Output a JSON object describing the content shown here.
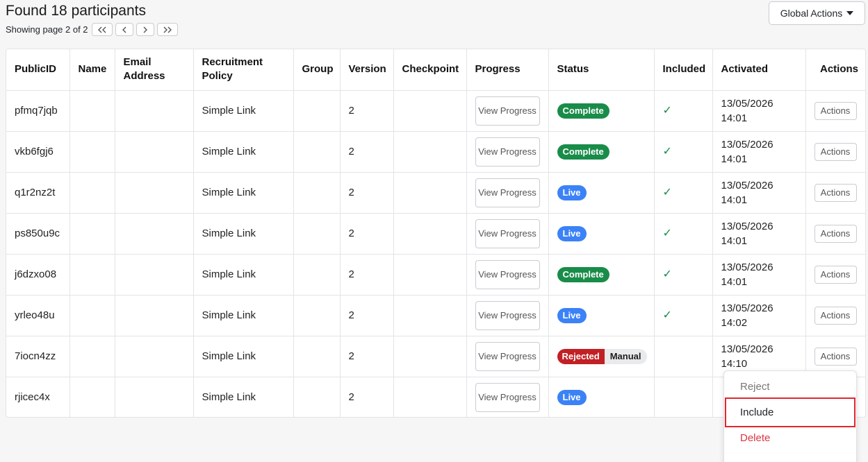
{
  "header": {
    "title": "Found 18 participants",
    "pagination_text": "Showing page 2 of 2",
    "global_actions_label": "Global Actions"
  },
  "table": {
    "columns": [
      "PublicID",
      "Name",
      "Email Address",
      "Recruitment Policy",
      "Group",
      "Version",
      "Checkpoint",
      "Progress",
      "Status",
      "Included",
      "Activated",
      "Actions"
    ],
    "view_progress_label": "View Progress",
    "actions_label": "Actions",
    "rows": [
      {
        "public_id": "pfmq7jqb",
        "name": "",
        "email": "",
        "policy": "Simple Link",
        "group": "",
        "version": "2",
        "checkpoint": "",
        "status": "Complete",
        "status2": "",
        "included": "✓",
        "activated": "13/05/2026 14:01"
      },
      {
        "public_id": "vkb6fgj6",
        "name": "",
        "email": "",
        "policy": "Simple Link",
        "group": "",
        "version": "2",
        "checkpoint": "",
        "status": "Complete",
        "status2": "",
        "included": "✓",
        "activated": "13/05/2026 14:01"
      },
      {
        "public_id": "q1r2nz2t",
        "name": "",
        "email": "",
        "policy": "Simple Link",
        "group": "",
        "version": "2",
        "checkpoint": "",
        "status": "Live",
        "status2": "",
        "included": "✓",
        "activated": "13/05/2026 14:01"
      },
      {
        "public_id": "ps850u9c",
        "name": "",
        "email": "",
        "policy": "Simple Link",
        "group": "",
        "version": "2",
        "checkpoint": "",
        "status": "Live",
        "status2": "",
        "included": "✓",
        "activated": "13/05/2026 14:01"
      },
      {
        "public_id": "j6dzxo08",
        "name": "",
        "email": "",
        "policy": "Simple Link",
        "group": "",
        "version": "2",
        "checkpoint": "",
        "status": "Complete",
        "status2": "",
        "included": "✓",
        "activated": "13/05/2026 14:01"
      },
      {
        "public_id": "yrleo48u",
        "name": "",
        "email": "",
        "policy": "Simple Link",
        "group": "",
        "version": "2",
        "checkpoint": "",
        "status": "Live",
        "status2": "",
        "included": "✓",
        "activated": "13/05/2026 14:02"
      },
      {
        "public_id": "7iocn4zz",
        "name": "",
        "email": "",
        "policy": "Simple Link",
        "group": "",
        "version": "2",
        "checkpoint": "",
        "status": "Rejected",
        "status2": "Manual",
        "included": "",
        "activated": "13/05/2026 14:10"
      },
      {
        "public_id": "rjicec4x",
        "name": "",
        "email": "",
        "policy": "Simple Link",
        "group": "",
        "version": "2",
        "checkpoint": "",
        "status": "Live",
        "status2": "",
        "included": "",
        "activated": ""
      }
    ]
  },
  "actions_menu": {
    "items": [
      "Reject",
      "Include",
      "Delete"
    ],
    "highlighted": "Include"
  },
  "colors": {
    "complete": "#198c49",
    "live": "#3b82f6",
    "rejected": "#c12025",
    "delete": "#dc3545",
    "highlight_border": "#e0262e"
  }
}
